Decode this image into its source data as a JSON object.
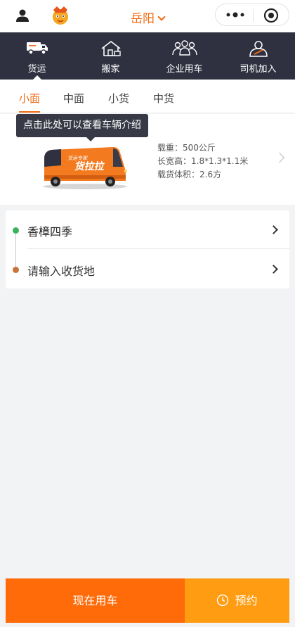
{
  "header": {
    "city": "岳阳"
  },
  "services": [
    {
      "label": "货运",
      "icon": "truck-icon",
      "active": true
    },
    {
      "label": "搬家",
      "icon": "house-icon",
      "active": false
    },
    {
      "label": "企业用车",
      "icon": "team-icon",
      "active": false
    },
    {
      "label": "司机加入",
      "icon": "driver-icon",
      "active": false
    }
  ],
  "vehicle_tabs": [
    {
      "label": "小面",
      "active": true
    },
    {
      "label": "中面",
      "active": false
    },
    {
      "label": "小货",
      "active": false
    },
    {
      "label": "中货",
      "active": false
    }
  ],
  "vehicle": {
    "tooltip": "点击此处可以查看车辆介绍",
    "load": "载重：500公斤",
    "dimensions": "长宽高：1.8*1.3*1.1米",
    "volume": "载货体积：2.6方",
    "logo_text": "货拉拉"
  },
  "address": {
    "pickup": "香樟四季",
    "dropoff": "请输入收货地",
    "pickup_color": "#3cb35a",
    "dropoff_color": "#c8733a"
  },
  "actions": {
    "now": "现在用车",
    "book": "预约"
  },
  "colors": {
    "accent": "#f06a14",
    "nav_bg": "#2f3040",
    "now_btn": "#fe6b08",
    "book_btn": "#ff9c12"
  }
}
